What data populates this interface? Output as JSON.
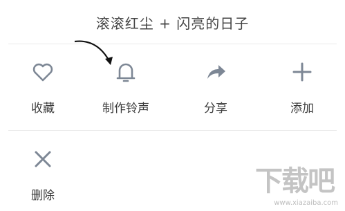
{
  "sheet": {
    "title": "滚滚红尘 + 闪亮的日子"
  },
  "actions": {
    "favorite_label": "收藏",
    "ringtone_label": "制作铃声",
    "share_label": "分享",
    "add_label": "添加",
    "delete_label": "删除"
  },
  "colors": {
    "icon": "#7d8795",
    "text": "#3b3b3b",
    "divider": "#e9e9e9"
  },
  "watermark": {
    "logo_text": "下载吧",
    "url": "www.xiazaiba.com"
  }
}
